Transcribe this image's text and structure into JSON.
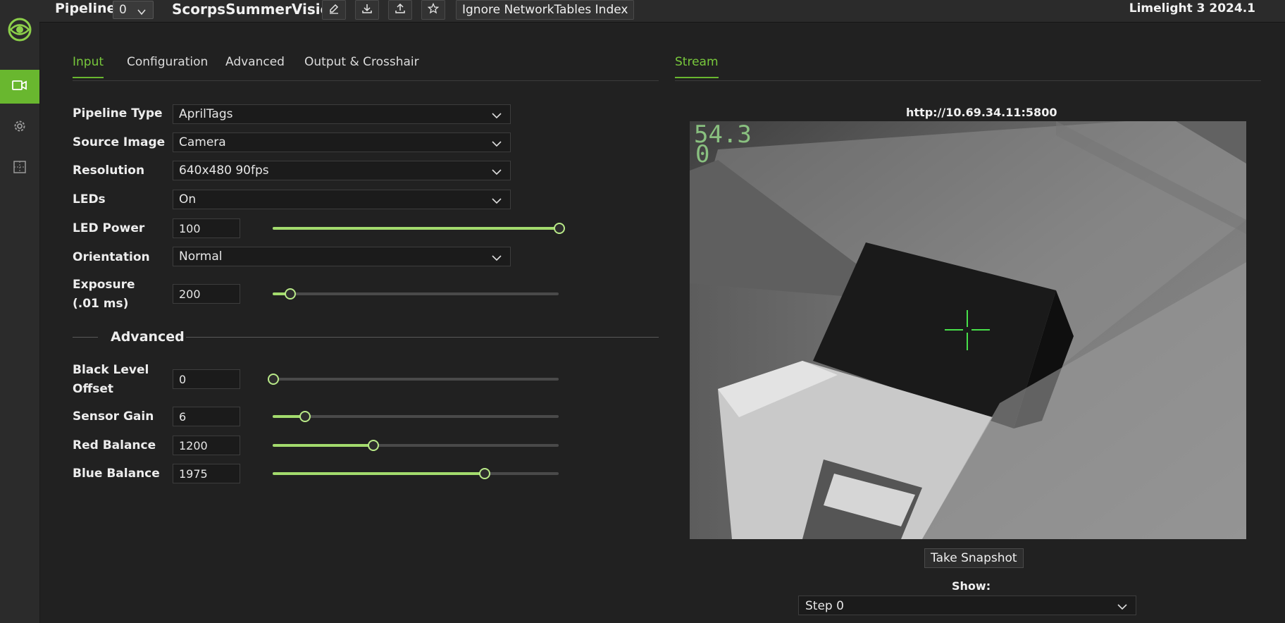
{
  "app": {
    "version": "Limelight 3 2024.1"
  },
  "colors": {
    "accent": "#69b72f",
    "accent_light": "#a3db6d",
    "background": "#212121",
    "sidebar": "#2b2b2b"
  },
  "sidebar": {
    "items": [
      {
        "icon": "limelight-logo-icon"
      },
      {
        "icon": "camera-icon",
        "active": true
      },
      {
        "icon": "gear-icon"
      },
      {
        "icon": "grid-icon"
      }
    ]
  },
  "header": {
    "pipeline_label": "Pipeline:",
    "pipeline_index": "0",
    "pipeline_name": "ScorpsSummerVision",
    "tool_icons": [
      "pencil-icon",
      "download-icon",
      "upload-icon",
      "star-icon"
    ],
    "ignore_nt_button": "Ignore NetworkTables Index"
  },
  "tabs": {
    "left": [
      "Input",
      "Configuration",
      "Advanced",
      "Output & Crosshair"
    ],
    "active_left": "Input",
    "right": [
      "Stream"
    ]
  },
  "input": {
    "pipeline_type": {
      "label": "Pipeline Type",
      "value": "AprilTags"
    },
    "source_image": {
      "label": "Source Image",
      "value": "Camera"
    },
    "resolution": {
      "label": "Resolution",
      "value": "640x480 90fps"
    },
    "leds": {
      "label": "LEDs",
      "value": "On"
    },
    "led_power": {
      "label": "LED Power",
      "value": "100",
      "level": 1.0
    },
    "orientation": {
      "label": "Orientation",
      "value": "Normal"
    },
    "exposure": {
      "label": "Exposure (.01 ms)",
      "value": "200",
      "level": 0.06
    }
  },
  "advanced": {
    "title": "Advanced",
    "black_level_offset": {
      "label": "Black Level Offset",
      "value": "0",
      "level": 0.0
    },
    "sensor_gain": {
      "label": "Sensor Gain",
      "value": "6",
      "level": 0.11
    },
    "red_balance": {
      "label": "Red Balance",
      "value": "1200",
      "level": 0.35
    },
    "blue_balance": {
      "label": "Blue Balance",
      "value": "1975",
      "level": 0.74
    }
  },
  "stream": {
    "url": "http://10.69.34.11:5800",
    "overlay_line1": "54.3",
    "overlay_line2": "0",
    "snapshot_button": "Take Snapshot",
    "show_label": "Show:",
    "show_value": "Step 0"
  }
}
